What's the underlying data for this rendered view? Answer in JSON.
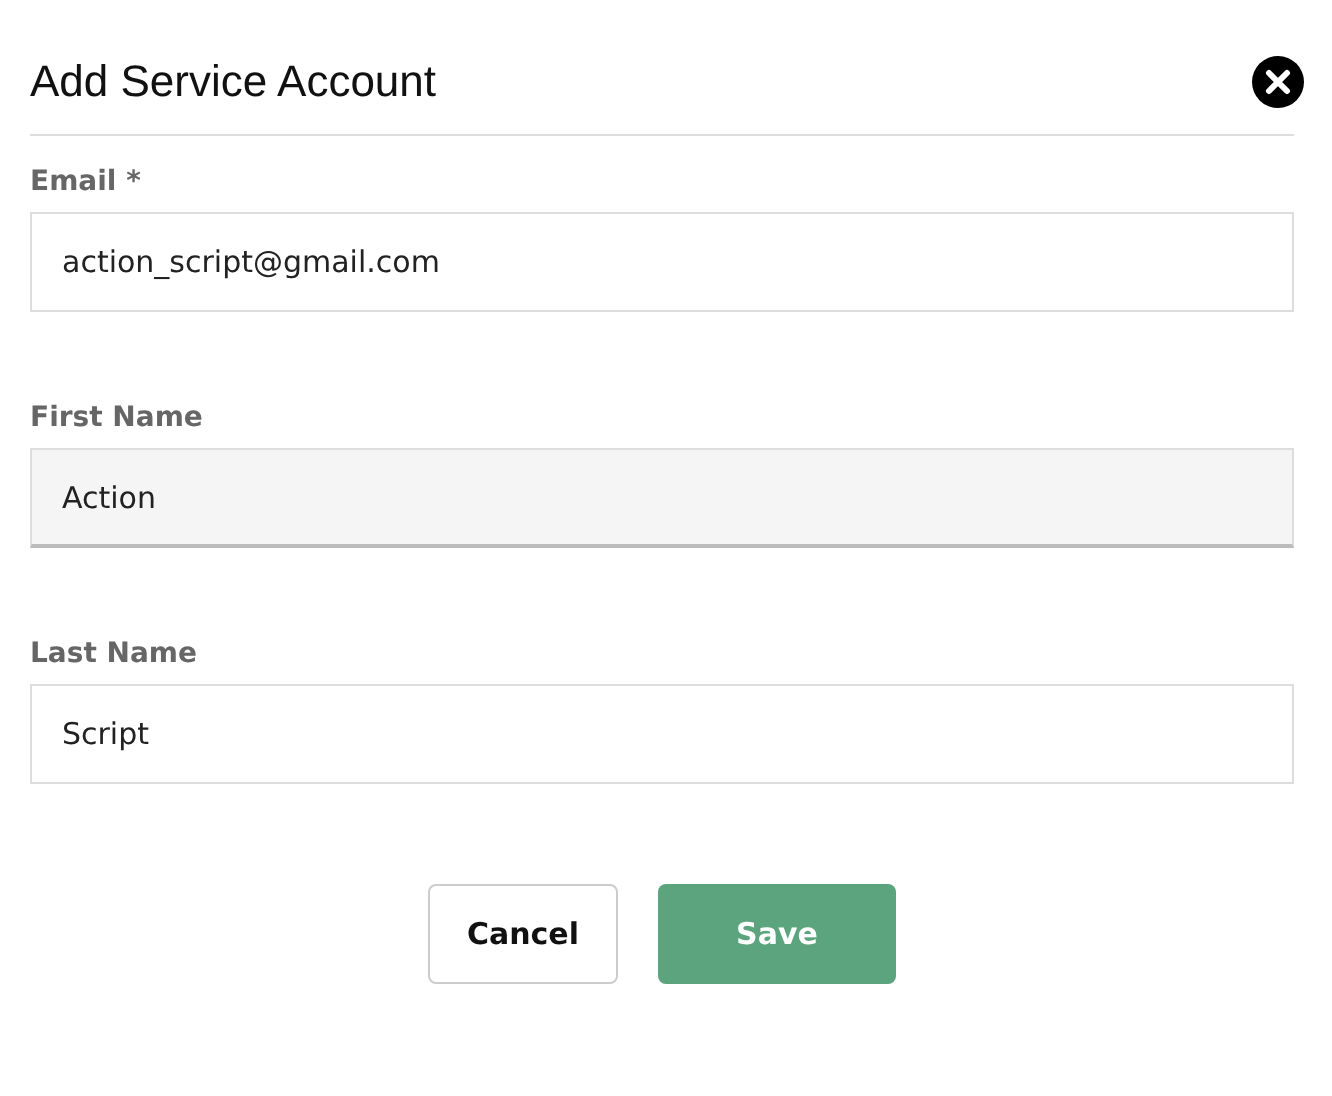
{
  "dialog": {
    "title": "Add Service Account"
  },
  "fields": [
    {
      "label": "Email *",
      "value": "action_script@gmail.com",
      "focused": false
    },
    {
      "label": "First Name",
      "value": "Action",
      "focused": true
    },
    {
      "label": "Last Name",
      "value": "Script",
      "focused": false
    }
  ],
  "buttons": [
    {
      "label": "Cancel",
      "kind": "secondary"
    },
    {
      "label": "Save",
      "kind": "primary"
    }
  ]
}
